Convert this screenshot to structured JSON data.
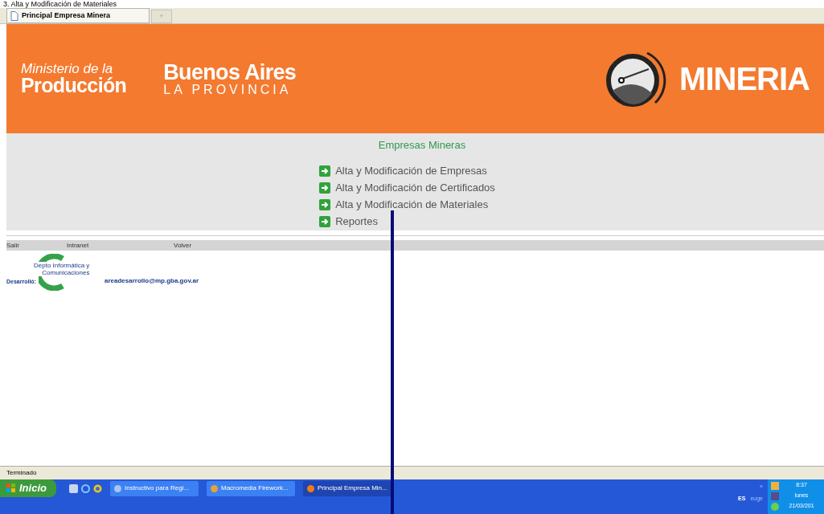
{
  "slide_title": "3. Alta y Modificación de Materiales",
  "browser": {
    "tabs": [
      {
        "label": "Principal Empresa Minera",
        "selected": true
      }
    ],
    "new_tab": "+"
  },
  "header": {
    "ministry_line1": "Ministerio de la",
    "ministry_line2": "Producción",
    "province_line1": "Buenos Aires",
    "province_line2": "LA PROVINCIA",
    "brand": "MINERIA"
  },
  "menu": {
    "title": "Empresas Mineras",
    "items": [
      {
        "label": "Alta y Modificación de Empresas"
      },
      {
        "label": "Alta y Modificación de Certificados"
      },
      {
        "label": "Alta y Modificación de Materiales"
      },
      {
        "label": "Reportes"
      }
    ]
  },
  "nav_links": [
    "Salir",
    "Intranet",
    "Volver"
  ],
  "footer": {
    "logo_line1": "Depto Informática y",
    "logo_line2": "Comunicaciones",
    "label": "Desarrolló:",
    "email": "areadesarrollo@mp.gba.gov.ar"
  },
  "status_bar": "Terminado",
  "taskbar": {
    "start": "Inicio",
    "tasks": [
      {
        "label": "Instructivo para Regi...",
        "selected": false
      },
      {
        "label": "Macromedia Firework...",
        "selected": false
      },
      {
        "label": "Principal Empresa Min...",
        "selected": true
      }
    ],
    "chevron": "»",
    "language": "ES",
    "user": "euge",
    "time": "8:37",
    "day": "lunes",
    "date": "21/03/201"
  }
}
